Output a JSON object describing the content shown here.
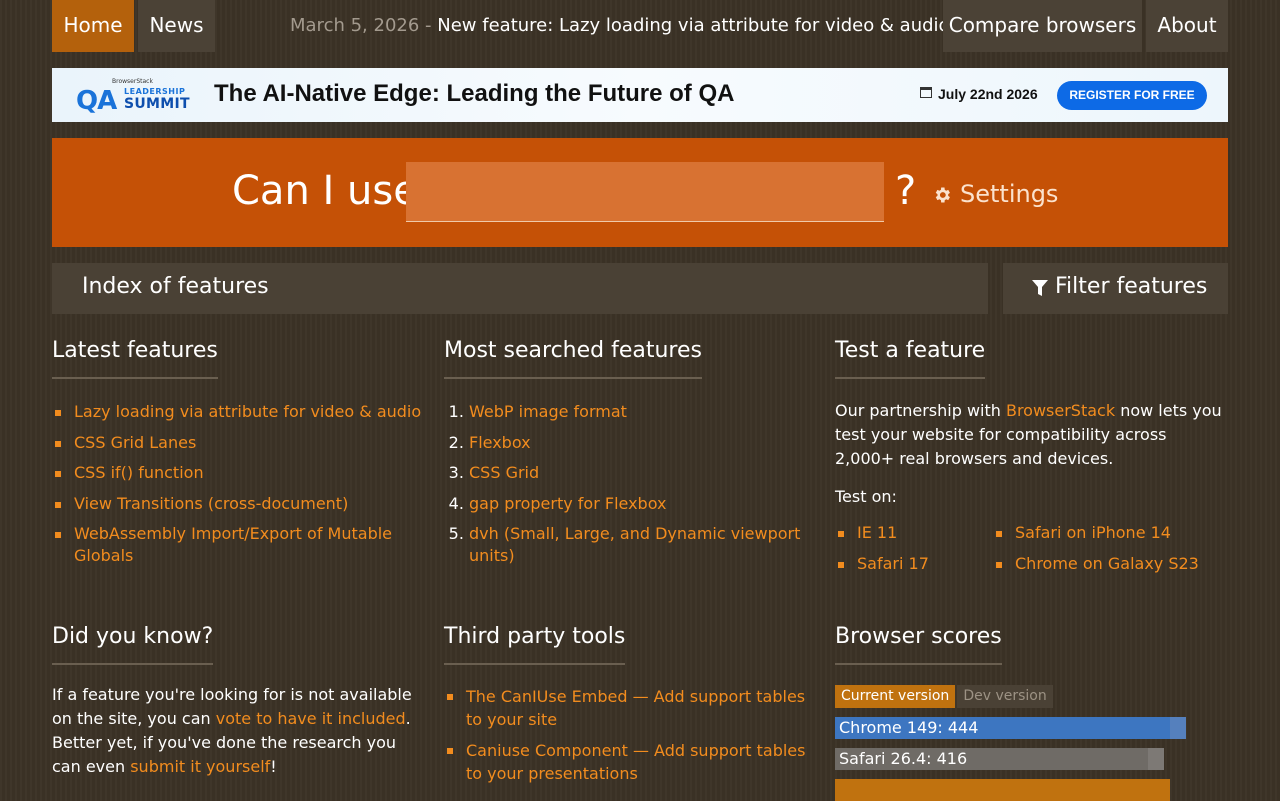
{
  "nav": {
    "home": "Home",
    "news": "News",
    "compare": "Compare browsers",
    "about": "About"
  },
  "news_banner": {
    "date": "March 5, 2026",
    "separator": "-",
    "text": "New feature: Lazy loading via attribute for video & audio"
  },
  "ad": {
    "logo_brand": "BrowserStack",
    "logo_qa": "QA",
    "logo_leadership": "LEADERSHIP",
    "logo_summit": "SUMMIT",
    "headline": "The AI-Native Edge: Leading the Future of QA",
    "date": "July 22nd 2026",
    "cta": "REGISTER FOR FREE"
  },
  "search": {
    "label": "Can I use",
    "value": "",
    "question_mark": "?",
    "settings": "Settings"
  },
  "index": {
    "title": "Index of features",
    "filter": "Filter features"
  },
  "latest": {
    "title": "Latest features",
    "items": [
      "Lazy loading via attribute for video & audio",
      "CSS Grid Lanes",
      "CSS if() function",
      "View Transitions (cross-document)",
      "WebAssembly Import/Export of Mutable Globals"
    ]
  },
  "most_searched": {
    "title": "Most searched features",
    "items": [
      "WebP image format",
      "Flexbox",
      "CSS Grid",
      "gap property for Flexbox",
      "dvh (Small, Large, and Dynamic viewport units)"
    ]
  },
  "test_feature": {
    "title": "Test a feature",
    "intro_before": "Our partnership with ",
    "intro_link": "BrowserStack",
    "intro_after": " now lets you test your website for compatibility across 2,000+ real browsers and devices.",
    "test_on": "Test on:",
    "left_items": [
      "IE 11",
      "Safari 17"
    ],
    "right_items": [
      "Safari on iPhone 14",
      "Chrome on Galaxy S23"
    ]
  },
  "did_you_know": {
    "title": "Did you know?",
    "text1": "If a feature you're looking for is not available on the site, you can ",
    "link1": "vote to have it included",
    "text2": ". Better yet, if you've done the research you can even ",
    "link2": "submit it yourself",
    "text3": "!"
  },
  "third_party": {
    "title": "Third party tools",
    "items": [
      "The CanIUse Embed — Add support tables to your site",
      "Caniuse Component — Add support tables to your presentations"
    ]
  },
  "browser_scores": {
    "title": "Browser scores",
    "tab_current": "Current version",
    "tab_dev": "Dev version",
    "scores": [
      {
        "label": "Chrome 149: 444",
        "value": 444,
        "color": "#3d76c1",
        "track": "#5580bd"
      },
      {
        "label": "Safari 26.4: 416",
        "value": 416,
        "color": "#6f6b66",
        "track": "#7d7975"
      }
    ],
    "partial_third_color": "#c0720f"
  }
}
